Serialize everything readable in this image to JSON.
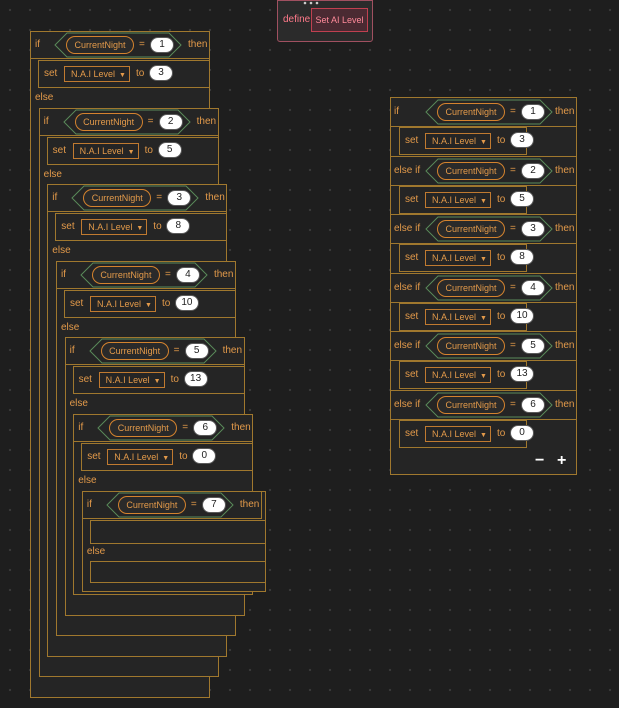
{
  "define": {
    "keyword": "define",
    "name": "Set AI Level"
  },
  "kw": {
    "if": "if",
    "then": "then",
    "else": "else",
    "else_if": "else  if",
    "set": "set",
    "to": "to",
    "eq": "="
  },
  "variable": "CurrentNight",
  "dropdown": "N.A.I Level",
  "nested": [
    {
      "night": "1",
      "level": "3"
    },
    {
      "night": "2",
      "level": "5"
    },
    {
      "night": "3",
      "level": "8"
    },
    {
      "night": "4",
      "level": "10"
    },
    {
      "night": "5",
      "level": "13"
    },
    {
      "night": "6",
      "level": "0"
    },
    {
      "night": "7"
    }
  ],
  "chain": [
    {
      "night": "1",
      "level": "3"
    },
    {
      "night": "2",
      "level": "5"
    },
    {
      "night": "3",
      "level": "8"
    },
    {
      "night": "4",
      "level": "10"
    },
    {
      "night": "5",
      "level": "13"
    },
    {
      "night": "6",
      "level": "0"
    }
  ],
  "controls": {
    "minus": "−",
    "plus": "+"
  },
  "colors": {
    "block_border": "#a0782e",
    "block_fill": "#252525",
    "text": "#e39a4a",
    "define_border": "#c04050"
  }
}
